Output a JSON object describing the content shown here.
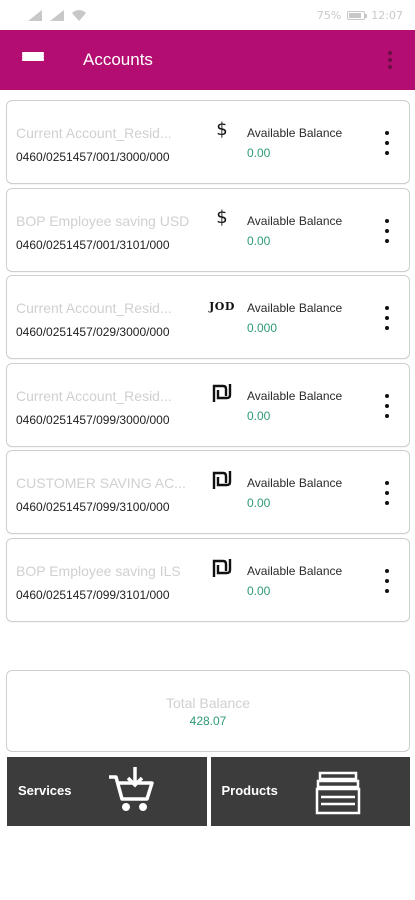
{
  "status_bar": {
    "battery": "75%",
    "time": "12:07",
    "battery_level": 0.75,
    "icons": [
      "signal-icon",
      "signal-icon",
      "wifi-icon",
      "battery-icon"
    ]
  },
  "app_bar": {
    "title": "Accounts",
    "color": "#b40d72"
  },
  "accounts": [
    {
      "name": "Current Account_Resid...",
      "number": "0460/0251457/001/3000/000",
      "currency_symbol": "$",
      "currency_icon": "dollar-icon",
      "balance_label": "Available Balance",
      "balance": "0.00"
    },
    {
      "name": "BOP Employee saving USD",
      "number": "0460/0251457/001/3101/000",
      "currency_symbol": "$",
      "currency_icon": "dollar-icon",
      "balance_label": "Available Balance",
      "balance": "0.00"
    },
    {
      "name": "Current Account_Resid...",
      "number": "0460/0251457/029/3000/000",
      "currency_symbol": "JOD",
      "currency_icon": "jod-icon",
      "balance_label": "Available Balance",
      "balance": "0.000"
    },
    {
      "name": "Current Account_Resid...",
      "number": "0460/0251457/099/3000/000",
      "currency_symbol": "₪",
      "currency_icon": "shekel-icon",
      "balance_label": "Available Balance",
      "balance": "0.00"
    },
    {
      "name": "CUSTOMER SAVING AC...",
      "number": "0460/0251457/099/3100/000",
      "currency_symbol": "₪",
      "currency_icon": "shekel-icon",
      "balance_label": "Available Balance",
      "balance": "0.00"
    },
    {
      "name": "BOP Employee saving ILS",
      "number": "0460/0251457/099/3101/000",
      "currency_symbol": "₪",
      "currency_icon": "shekel-icon",
      "balance_label": "Available Balance",
      "balance": "0.00"
    }
  ],
  "total": {
    "label": "Total Balance",
    "value": "428.07"
  },
  "bottom_nav": {
    "services_label": "Services",
    "services_icon": "cart-add-icon",
    "products_label": "Products",
    "products_icon": "stack-icon"
  },
  "colors": {
    "accent": "#b40d72",
    "balance_green": "#2e9a73",
    "tile_bg": "#3c3c3c"
  }
}
